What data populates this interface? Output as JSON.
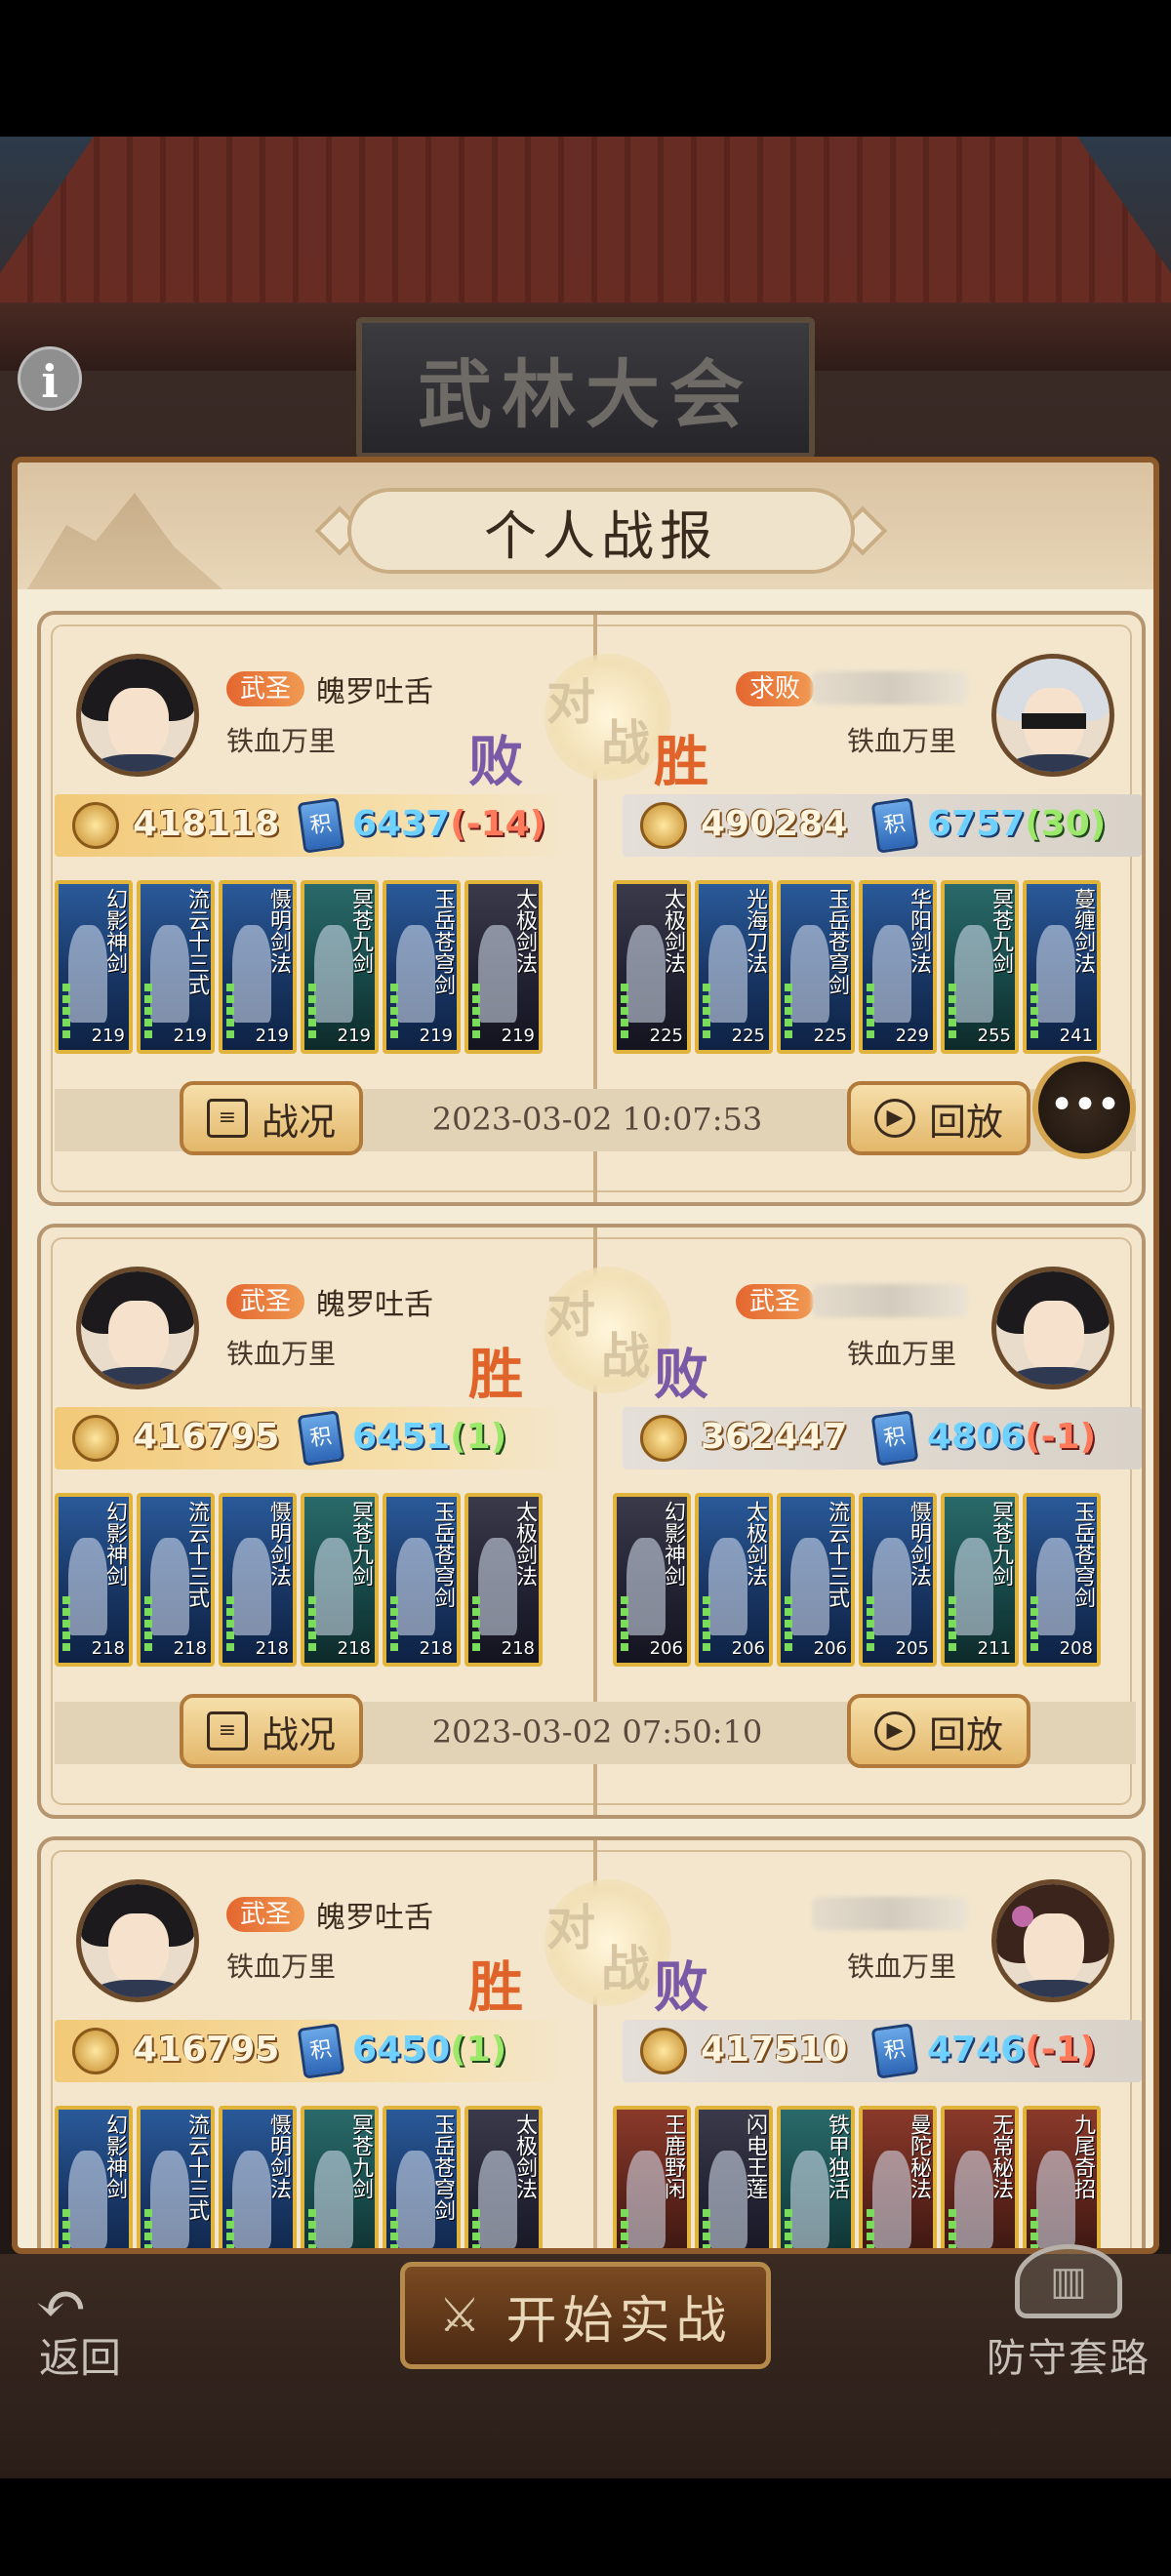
{
  "header": {
    "sign_title": "武林大会",
    "info_icon": "i"
  },
  "panel": {
    "title": "个人战报"
  },
  "vs_chars": [
    "对",
    "战"
  ],
  "battles": [
    {
      "left": {
        "rank": "武圣",
        "name": "魄罗吐舌",
        "guild": "铁血万里",
        "result": "败",
        "power": "418118",
        "score": "6437",
        "delta": "(-14)",
        "heroes": [
          {
            "name": "幻影神剑",
            "level": "219"
          },
          {
            "name": "流云十三式",
            "level": "219"
          },
          {
            "name": "慑明剑法",
            "level": "219"
          },
          {
            "name": "冥苍九剑",
            "level": "219"
          },
          {
            "name": "玉岳苍穹剑",
            "level": "219"
          },
          {
            "name": "太极剑法",
            "level": "219"
          }
        ]
      },
      "right": {
        "rank": "求败",
        "name": "",
        "guild": "铁血万里",
        "result": "胜",
        "power": "490284",
        "score": "6757",
        "delta": "(30)",
        "heroes": [
          {
            "name": "太极剑法",
            "level": "225"
          },
          {
            "name": "光海刀法",
            "level": "225"
          },
          {
            "name": "玉岳苍穹剑",
            "level": "225"
          },
          {
            "name": "华阳剑法",
            "level": "229"
          },
          {
            "name": "冥苍九剑",
            "level": "255"
          },
          {
            "name": "蔓缠剑法",
            "level": "241"
          }
        ]
      },
      "report_label": "战况",
      "time": "2023-03-02 10:07:53",
      "replay_label": "回放"
    },
    {
      "left": {
        "rank": "武圣",
        "name": "魄罗吐舌",
        "guild": "铁血万里",
        "result": "胜",
        "power": "416795",
        "score": "6451",
        "delta": "(1)",
        "heroes": [
          {
            "name": "幻影神剑",
            "level": "218"
          },
          {
            "name": "流云十三式",
            "level": "218"
          },
          {
            "name": "慑明剑法",
            "level": "218"
          },
          {
            "name": "冥苍九剑",
            "level": "218"
          },
          {
            "name": "玉岳苍穹剑",
            "level": "218"
          },
          {
            "name": "太极剑法",
            "level": "218"
          }
        ]
      },
      "right": {
        "rank": "武圣",
        "name": "",
        "guild": "铁血万里",
        "result": "败",
        "power": "362447",
        "score": "4806",
        "delta": "(-1)",
        "heroes": [
          {
            "name": "幻影神剑",
            "level": "206"
          },
          {
            "name": "太极剑法",
            "level": "206"
          },
          {
            "name": "流云十三式",
            "level": "206"
          },
          {
            "name": "慑明剑法",
            "level": "205"
          },
          {
            "name": "冥苍九剑",
            "level": "211"
          },
          {
            "name": "玉岳苍穹剑",
            "level": "208"
          }
        ]
      },
      "report_label": "战况",
      "time": "2023-03-02 07:50:10",
      "replay_label": "回放"
    },
    {
      "left": {
        "rank": "武圣",
        "name": "魄罗吐舌",
        "guild": "铁血万里",
        "result": "胜",
        "power": "416795",
        "score": "6450",
        "delta": "(1)",
        "heroes": [
          {
            "name": "幻影神剑",
            "level": ""
          },
          {
            "name": "流云十三式",
            "level": ""
          },
          {
            "name": "慑明剑法",
            "level": ""
          },
          {
            "name": "冥苍九剑",
            "level": ""
          },
          {
            "name": "玉岳苍穹剑",
            "level": ""
          },
          {
            "name": "太极剑法",
            "level": ""
          }
        ]
      },
      "right": {
        "rank": "",
        "name": "",
        "guild": "铁血万里",
        "result": "败",
        "power": "417510",
        "score": "4746",
        "delta": "(-1)",
        "heroes": [
          {
            "name": "王鹿野闲",
            "level": ""
          },
          {
            "name": "闪电王莲",
            "level": ""
          },
          {
            "name": "铁甲独活",
            "level": ""
          },
          {
            "name": "曼陀秘法",
            "level": ""
          },
          {
            "name": "无常秘法",
            "level": ""
          },
          {
            "name": "九尾奇招",
            "level": ""
          }
        ]
      },
      "report_label": "",
      "time": "",
      "replay_label": ""
    }
  ],
  "chat": {
    "icon": "•••"
  },
  "bottom": {
    "back_label": "返回",
    "start_label": "开始实战",
    "defense_label": "防守套路"
  },
  "colors": {
    "win": "#e0632a",
    "lose": "#7a5aa6",
    "panel_bg": "#f5ecd8",
    "border": "#8e5a2c"
  }
}
